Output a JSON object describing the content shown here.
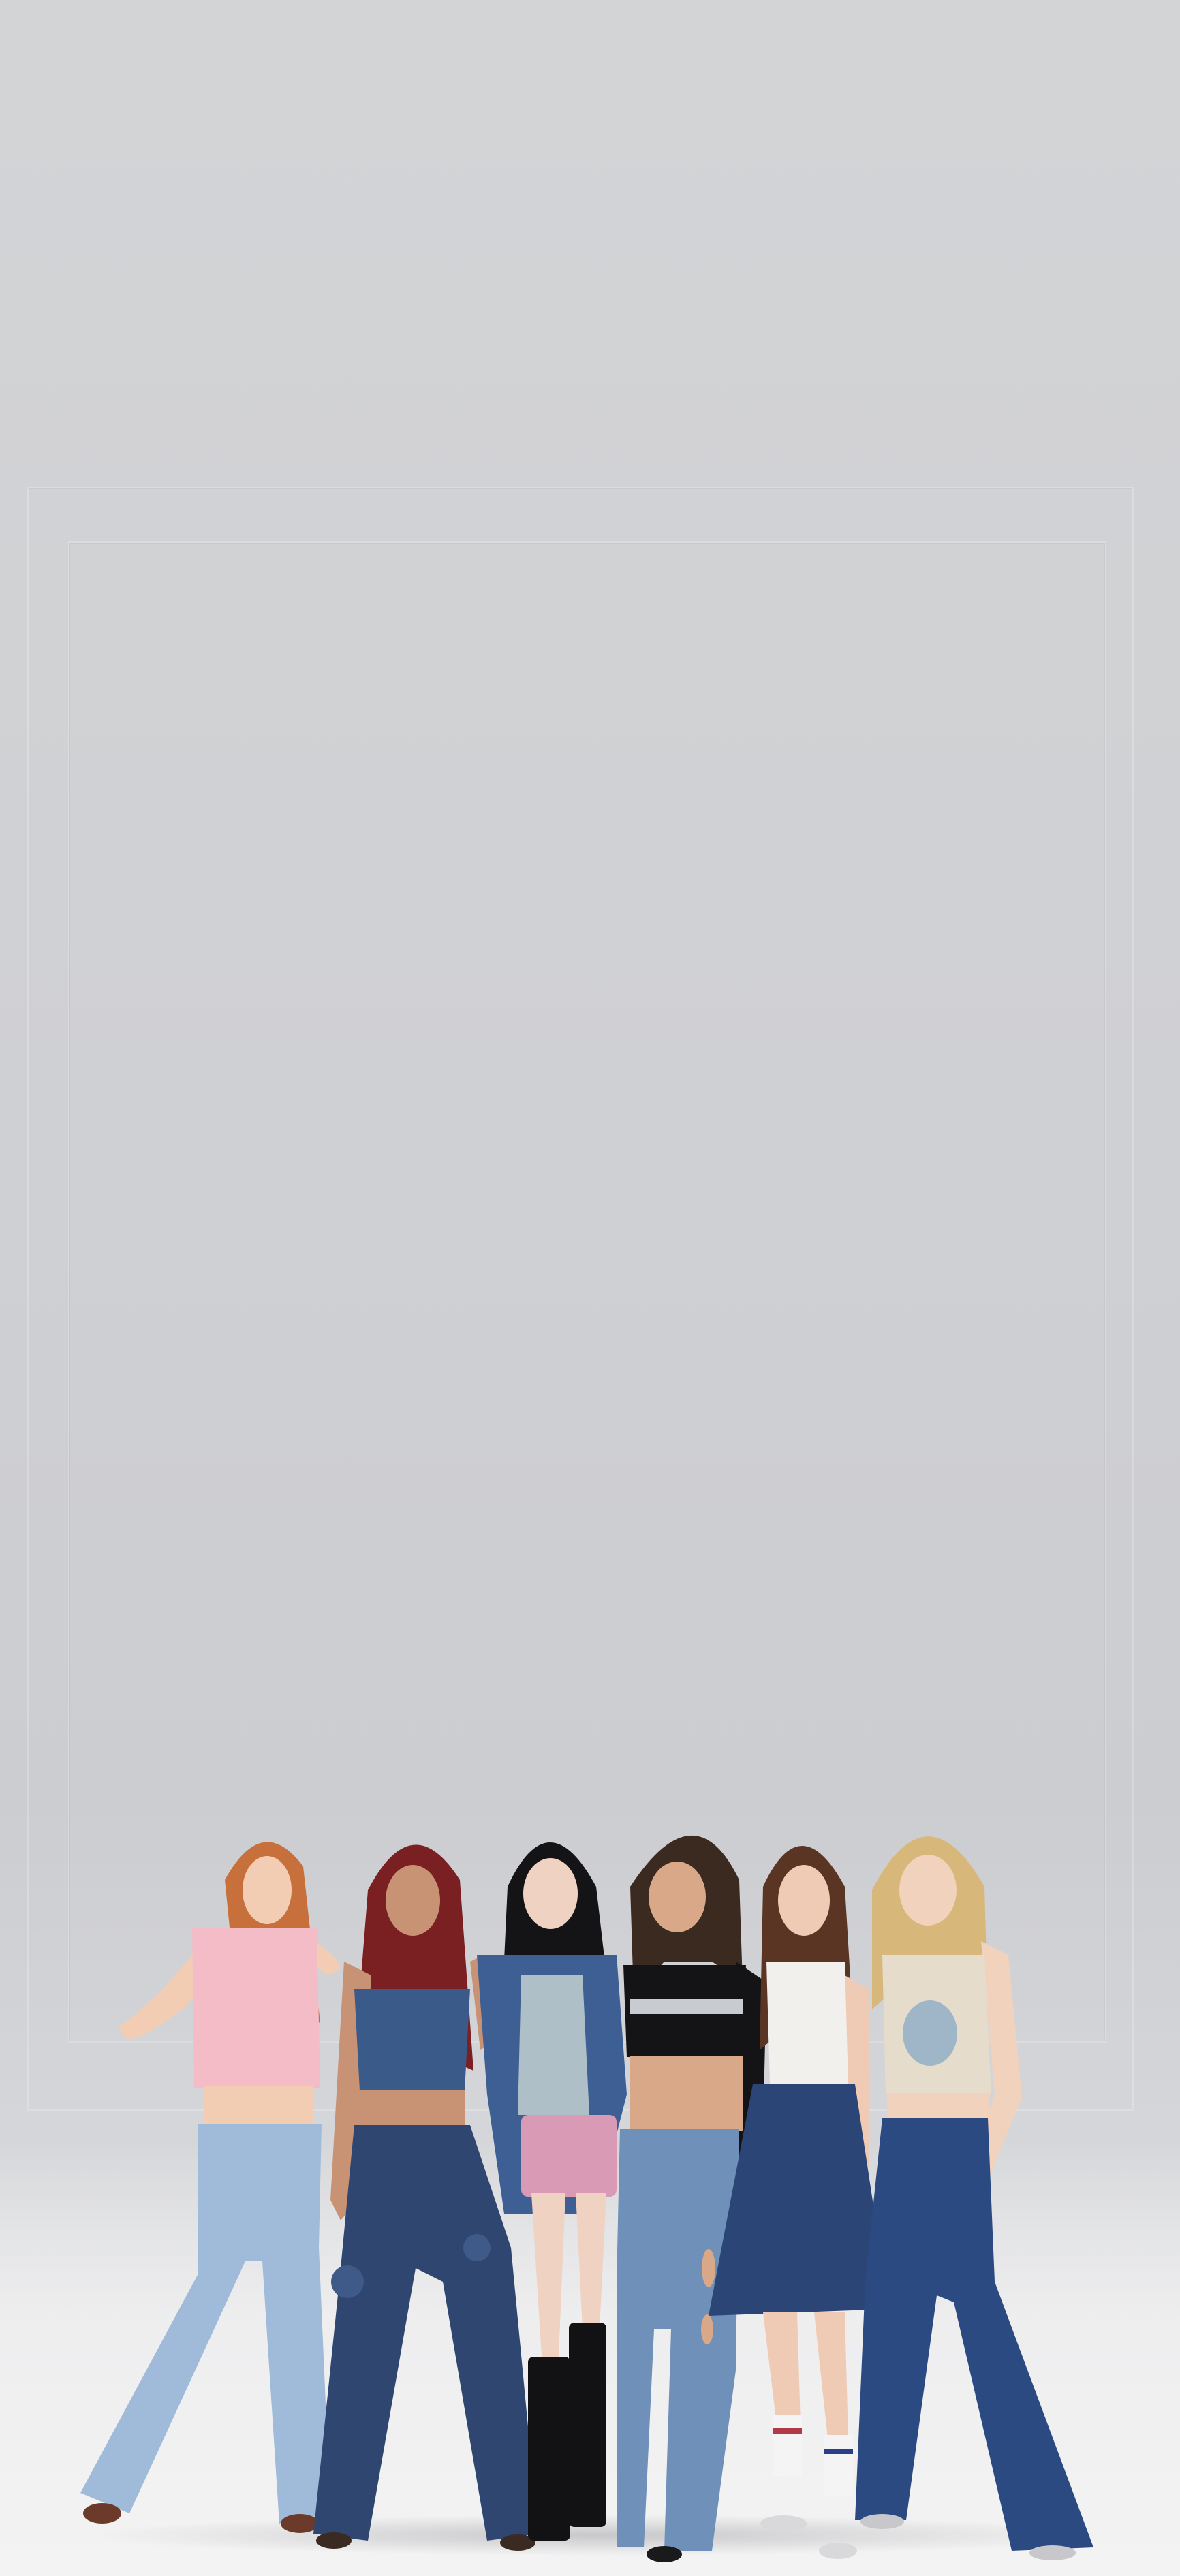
{
  "scene": {
    "background_color": "#cfd0d3",
    "floor_color": "#f3f3f3"
  },
  "figures": [
    {
      "name": "figure-1",
      "hair": "#c8703c",
      "skin": "#f2cdb4",
      "top": "#f4bcc6",
      "bottom": "#9fbbd9",
      "shoes": "#6b3a2a"
    },
    {
      "name": "figure-2",
      "hair": "#7a1f22",
      "skin": "#c89274",
      "top": "#3a5a8a",
      "bottom": "#2f4670",
      "shoes": "#3a2a22"
    },
    {
      "name": "figure-3",
      "hair": "#141416",
      "skin": "#f0d2c2",
      "top": "#3d5f94",
      "bottom": "#d99ab6",
      "shoes": "#121214"
    },
    {
      "name": "figure-4",
      "hair": "#3b2a20",
      "skin": "#d8a888",
      "top": "#141416",
      "bottom": "#6f90b8",
      "shoes": "#1a1a1c"
    },
    {
      "name": "figure-5",
      "hair": "#5b3524",
      "skin": "#efcbb6",
      "top": "#f1f0ec",
      "bottom": "#2b4676",
      "shoes": "#d9d9dc"
    },
    {
      "name": "figure-6",
      "hair": "#d8b77a",
      "skin": "#f1d2bd",
      "top": "#e6dccb",
      "bottom": "#2c4a82",
      "shoes": "#c8c8cc"
    }
  ]
}
